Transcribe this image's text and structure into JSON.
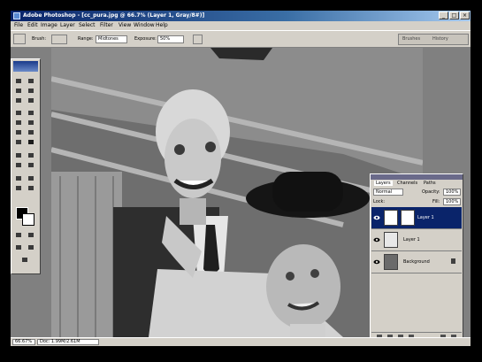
{
  "window": {
    "title": "Adobe Photoshop - [cc_pura.jpg @ 66.7% (Layer 1, Gray/8#)]",
    "buttons": {
      "minimize": "_",
      "maximize": "□",
      "close": "×"
    }
  },
  "menu": [
    "File",
    "Edit",
    "Image",
    "Layer",
    "Select",
    "Filter",
    "View",
    "Window",
    "Help"
  ],
  "options_bar": {
    "brush_label": "Brush:",
    "range_label": "Range:",
    "range_value": "Midtones",
    "exposure_label": "Exposure:",
    "exposure_value": "50%",
    "palette_tabs": [
      "Brushes",
      "History"
    ]
  },
  "layers_panel": {
    "tabs": [
      "Layers",
      "Channels",
      "Paths"
    ],
    "blend_mode": "Normal",
    "opacity_label": "Opacity:",
    "opacity_value": "100%",
    "lock_label": "Lock:",
    "fill_label": "Fill:",
    "fill_value": "100%",
    "layers": [
      {
        "name": "Layer 1",
        "selected": true
      },
      {
        "name": "Layer 1",
        "selected": false
      },
      {
        "name": "Background",
        "selected": false
      }
    ]
  },
  "status_bar": {
    "zoom": "66.67%",
    "doc_info": "Doc: 1.99M/2.61M"
  },
  "colors": {
    "title_start": "#0a246a",
    "title_end": "#a6caf0",
    "chrome": "#d4d0c8",
    "selection": "#0a246a",
    "foreground": "#000000",
    "background": "#ffffff"
  }
}
